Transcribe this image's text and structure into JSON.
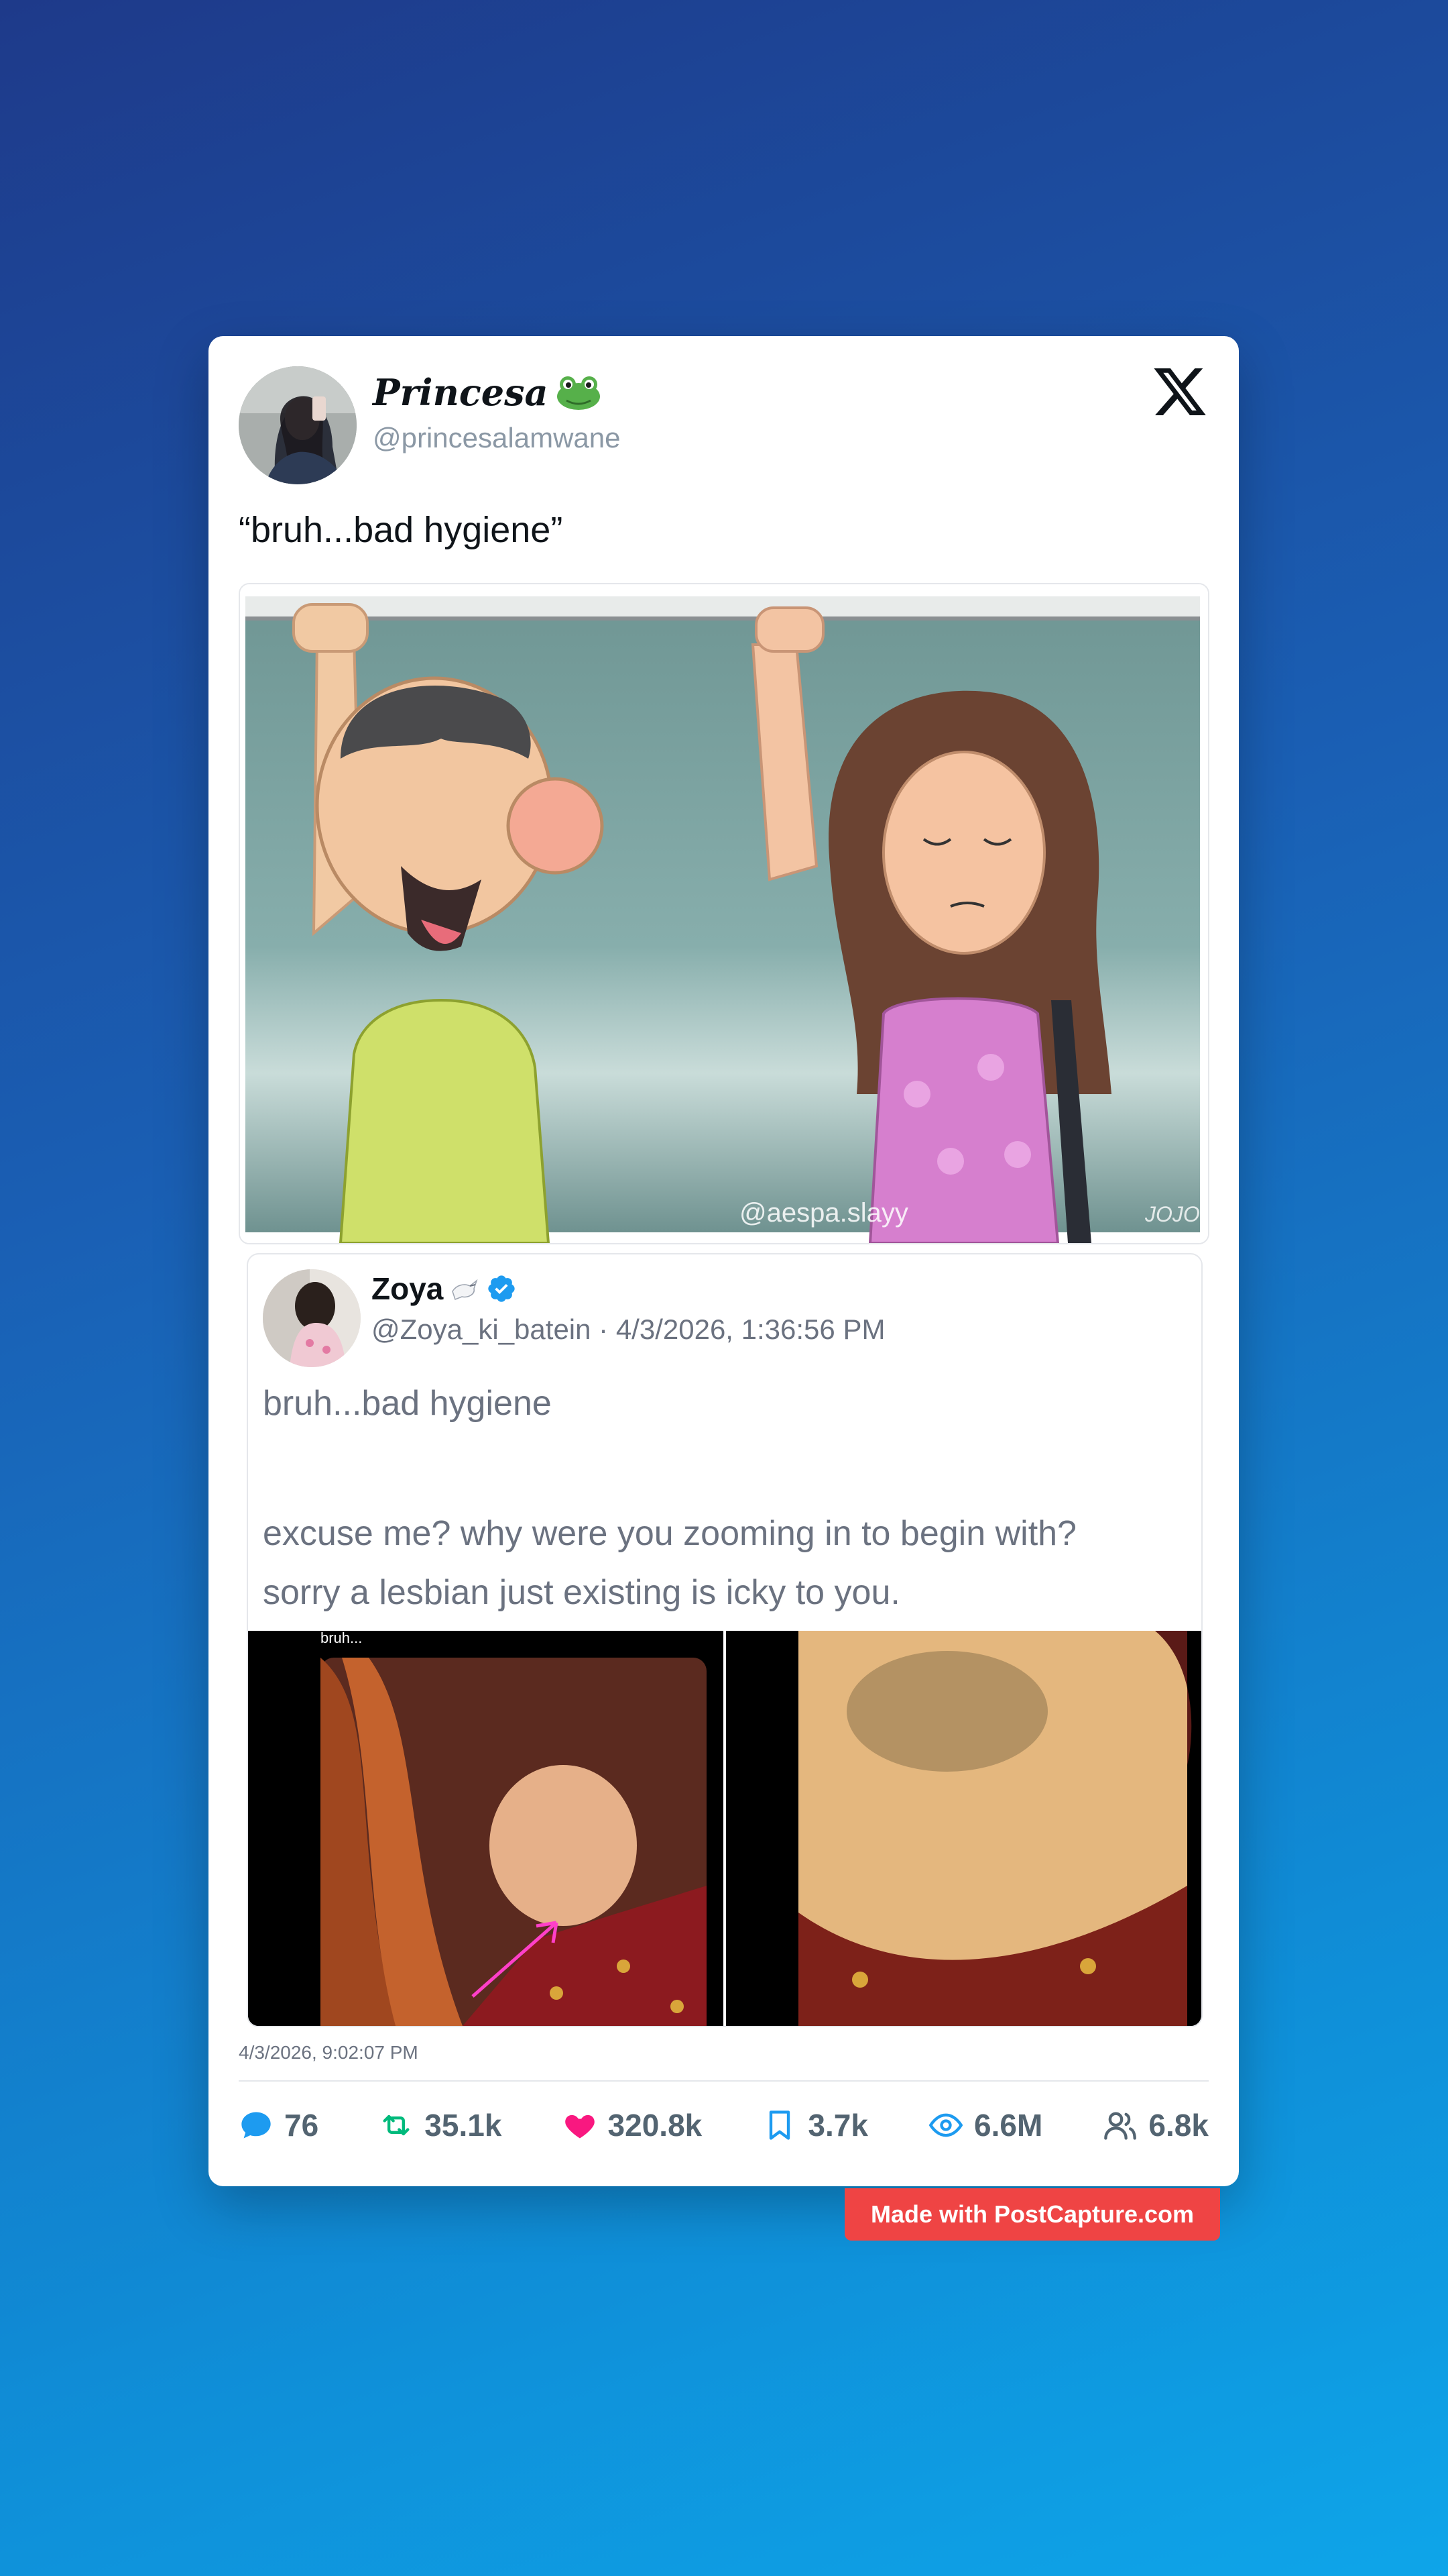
{
  "post": {
    "author": {
      "display_name": "Princesa",
      "emoji": "frog-emoji",
      "handle": "@princesalamwane"
    },
    "text": "“bruh...bad hygiene”",
    "media_watermark": "@aespa.slayy",
    "timestamp": "4/3/2026, 9:02:07 PM"
  },
  "quoted_post": {
    "author": {
      "display_name": "Zoya",
      "emoji": "dove-emoji",
      "verified": true,
      "handle": "@Zoya_ki_batein"
    },
    "meta": "@Zoya_ki_batein · 4/3/2026, 1:36:56 PM",
    "text_line1": "bruh...bad hygiene",
    "text_line2": "excuse me? why were you zooming in to begin with?",
    "text_line3": "sorry a lesbian just existing is icky to you.",
    "media_caption": "bruh..."
  },
  "stats": {
    "replies": "76",
    "reposts": "35.1k",
    "likes": "320.8k",
    "bookmarks": "3.7k",
    "views": "6.6M",
    "followers": "6.8k"
  },
  "colors": {
    "reply": "#1d9bf0",
    "repost": "#00ba7c",
    "like": "#f91880",
    "bookmark": "#1d9bf0",
    "views": "#1d9bf0",
    "badge": "#ef4444"
  },
  "branding": {
    "badge_text": "Made with PostCapture.com"
  }
}
